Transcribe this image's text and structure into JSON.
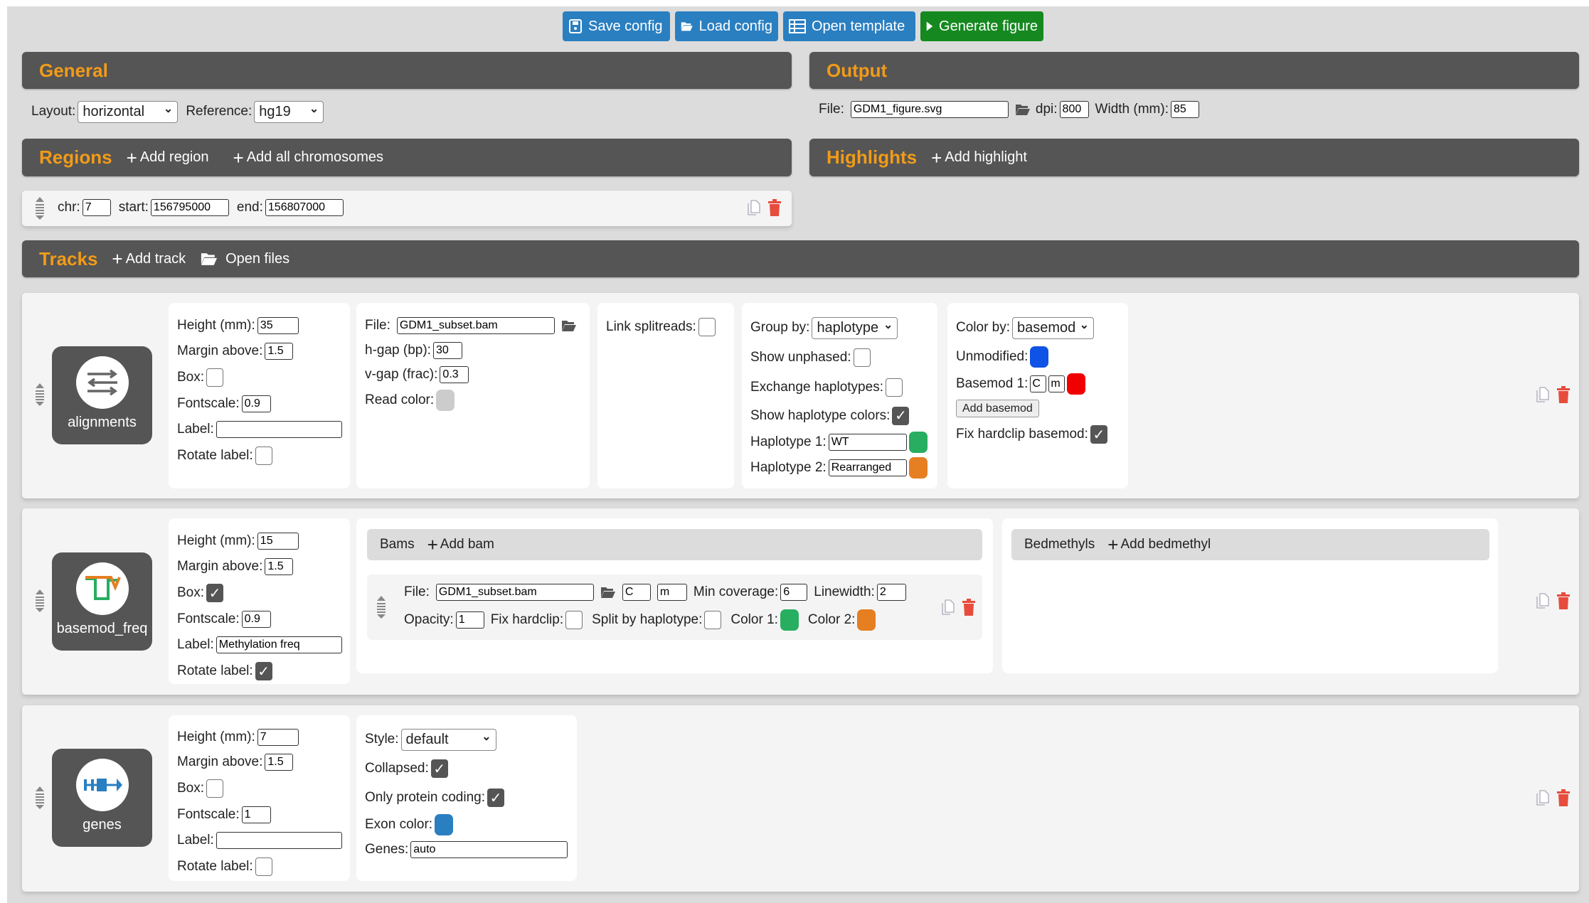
{
  "toolbar": {
    "save": "Save config",
    "load": "Load config",
    "template": "Open template",
    "generate": "Generate figure"
  },
  "general": {
    "title": "General",
    "layout_label": "Layout:",
    "layout": "horizontal",
    "reference_label": "Reference:",
    "reference": "hg19"
  },
  "output": {
    "title": "Output",
    "file_label": "File:",
    "file": "GDM1_figure.svg",
    "dpi_label": "dpi:",
    "dpi": "800",
    "width_label": "Width (mm):",
    "width": "85"
  },
  "regions": {
    "title": "Regions",
    "add_region": "Add region",
    "add_all": "Add all chromosomes",
    "items": [
      {
        "chr_label": "chr:",
        "chr": "7",
        "start_label": "start:",
        "start": "156795000",
        "end_label": "end:",
        "end": "156807000"
      }
    ]
  },
  "highlights": {
    "title": "Highlights",
    "add": "Add highlight"
  },
  "tracks_header": {
    "title": "Tracks",
    "add_track": "Add track",
    "open_files": "Open files"
  },
  "common_labels": {
    "height": "Height (mm):",
    "margin": "Margin above:",
    "box": "Box:",
    "fontscale": "Fontscale:",
    "label": "Label:",
    "rotate": "Rotate label:"
  },
  "tracks": [
    {
      "type": "alignments",
      "height": "35",
      "margin": "1.5",
      "box": false,
      "fontscale": "0.9",
      "label": "",
      "rotate": false,
      "file_label": "File:",
      "file": "GDM1_subset.bam",
      "hgap_label": "h-gap (bp):",
      "hgap": "30",
      "vgap_label": "v-gap (frac):",
      "vgap": "0.3",
      "read_color_label": "Read color:",
      "read_color": "#cccccc",
      "link_label": "Link splitreads:",
      "link": false,
      "group_label": "Group by:",
      "group": "haplotype",
      "unphased_label": "Show unphased:",
      "unphased": false,
      "exchange_label": "Exchange haplotypes:",
      "exchange": false,
      "hapcolors_label": "Show haplotype colors:",
      "hapcolors": true,
      "hap1_label": "Haplotype 1:",
      "hap1": "WT",
      "hap1_color": "#27ae60",
      "hap2_label": "Haplotype 2:",
      "hap2": "Rearranged",
      "hap2_color": "#e67e22",
      "colorby_label": "Color by:",
      "colorby": "basemod",
      "unmod_label": "Unmodified:",
      "unmod_color": "#0f52e6",
      "basemod1_label": "Basemod 1:",
      "basemod1_base": "C",
      "basemod1_mod": "m",
      "basemod1_color": "#f00000",
      "add_basemod": "Add basemod",
      "fixhc_label": "Fix hardclip basemod:",
      "fixhc": true
    },
    {
      "type": "basemod_freq",
      "height": "15",
      "margin": "1.5",
      "box": true,
      "fontscale": "0.9",
      "label": "Methylation freq",
      "rotate": true,
      "bams_title": "Bams",
      "add_bam": "Add bam",
      "bedmethyls_title": "Bedmethyls",
      "add_bedmethyl": "Add bedmethyl",
      "bams": [
        {
          "file_label": "File:",
          "file": "GDM1_subset.bam",
          "base": "C",
          "mod": "m",
          "mincov_label": "Min coverage:",
          "mincov": "6",
          "lw_label": "Linewidth:",
          "lw": "2",
          "opacity_label": "Opacity:",
          "opacity": "1",
          "fixhc_label": "Fix hardclip:",
          "fixhc": false,
          "split_label": "Split by haplotype:",
          "split": false,
          "c1_label": "Color 1:",
          "c1": "#27ae60",
          "c2_label": "Color 2:",
          "c2": "#e67e22"
        }
      ]
    },
    {
      "type": "genes",
      "height": "7",
      "margin": "1.5",
      "box": false,
      "fontscale": "1",
      "label": "",
      "rotate": false,
      "style_label": "Style:",
      "style": "default",
      "collapsed_label": "Collapsed:",
      "collapsed": true,
      "protein_label": "Only protein coding:",
      "protein": true,
      "exon_label": "Exon color:",
      "exon_color": "#2a7fc1",
      "genes_label": "Genes:",
      "genes": "auto"
    }
  ],
  "colors": {
    "header_bg": "#555555",
    "title_orange": "#f29b18",
    "button_blue": "#2a7fc1",
    "button_green": "#15891f",
    "delete_red": "#e74c3c"
  }
}
